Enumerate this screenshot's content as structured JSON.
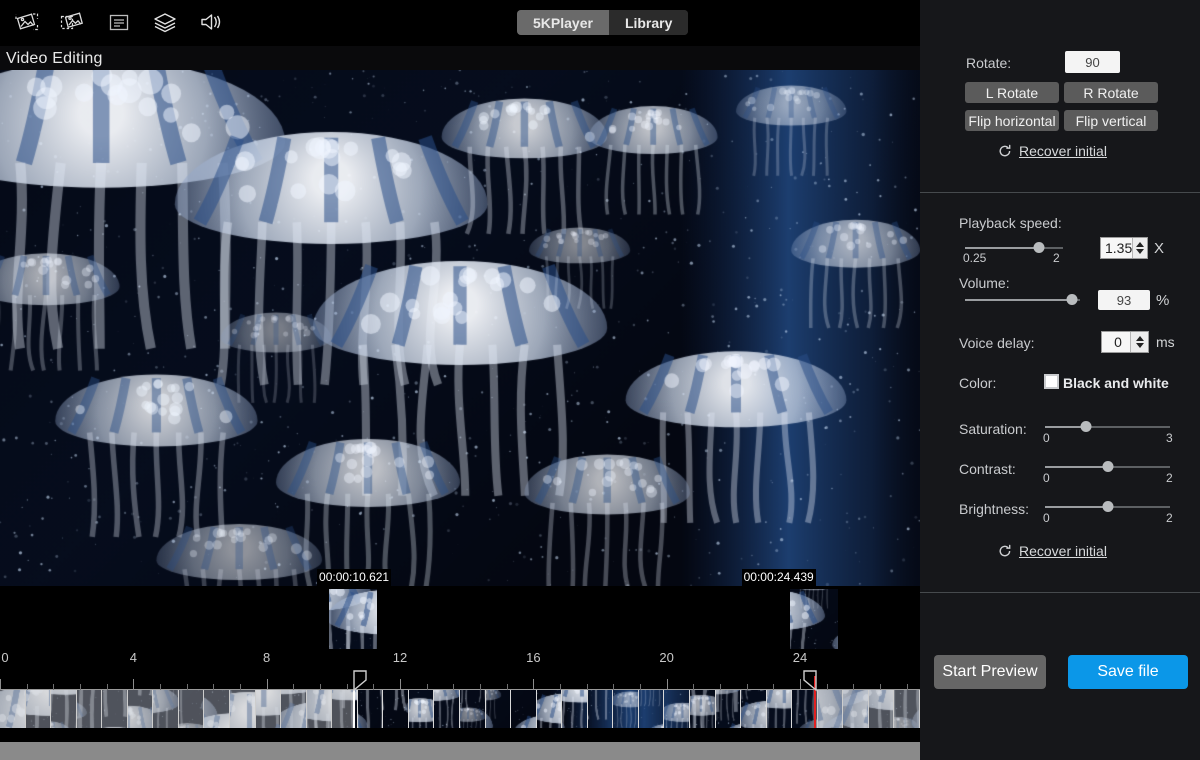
{
  "app": {
    "title": "5KPlayer",
    "panel_title": "Video Editing"
  },
  "toolbar": {
    "icons": [
      {
        "name": "crop-image-icon",
        "label": "Crop"
      },
      {
        "name": "rotate-image-icon",
        "label": "Rotate"
      },
      {
        "name": "subtitle-icon",
        "label": "Subtitle"
      },
      {
        "name": "layers-icon",
        "label": "Effects"
      },
      {
        "name": "volume-icon",
        "label": "Audio"
      }
    ]
  },
  "tabs": [
    {
      "id": "tab-5kplayer",
      "label": "5KPlayer",
      "active": true
    },
    {
      "id": "tab-library",
      "label": "Library",
      "active": false
    }
  ],
  "window_controls": [
    {
      "name": "restore-window-button",
      "glyph": "restore"
    },
    {
      "name": "back-button",
      "glyph": "arrow-left"
    }
  ],
  "rotate_section": {
    "label": "Rotate:",
    "value": "90",
    "buttons": [
      {
        "id": "l-rotate-button",
        "label": "L Rotate"
      },
      {
        "id": "r-rotate-button",
        "label": "R Rotate"
      },
      {
        "id": "flip-horizontal-button",
        "label": "Flip horizontal"
      },
      {
        "id": "flip-vertical-button",
        "label": "Flip vertical"
      }
    ],
    "recover_label": "Recover initial"
  },
  "playback_section": {
    "speed_label": "Playback speed:",
    "speed_min": "0.25",
    "speed_max": "2",
    "speed_value": "1.35",
    "speed_unit": "X",
    "speed_pct": 76,
    "volume_label": "Volume:",
    "volume_value": "93",
    "volume_unit": "%",
    "volume_pct": 93,
    "voice_delay_label": "Voice delay:",
    "voice_delay_value": "0",
    "voice_delay_unit": "ms"
  },
  "color_section": {
    "color_label": "Color:",
    "bw_label": "Black and white",
    "bw_checked": false,
    "sliders": [
      {
        "id": "saturation-slider",
        "label": "Saturation:",
        "min": "0",
        "max": "3",
        "pct": 33
      },
      {
        "id": "contrast-slider",
        "label": "Contrast:",
        "min": "0",
        "max": "2",
        "pct": 50
      },
      {
        "id": "brightness-slider",
        "label": "Brightness:",
        "min": "0",
        "max": "2",
        "pct": 50
      }
    ],
    "recover_label": "Recover initial"
  },
  "actions": {
    "start_preview_label": "Start Preview",
    "save_file_label": "Save file"
  },
  "timeline": {
    "in_time": "00:00:10.621",
    "out_time": "00:00:24.439",
    "tick_labels": [
      "0",
      "4",
      "8",
      "12",
      "16",
      "20",
      "24"
    ],
    "tick_values": [
      0,
      4,
      8,
      12,
      16,
      20,
      24
    ],
    "range_start_sec": 0,
    "range_end_sec": 27.6,
    "selection_start_sec": 10.621,
    "selection_end_sec": 24.439,
    "playhead_sec": 24.439
  },
  "colors": {
    "accent": "#0b97e8",
    "panel_bg": "#16171a",
    "button_grey": "#5b5b5b",
    "playhead_red": "#e02020"
  }
}
